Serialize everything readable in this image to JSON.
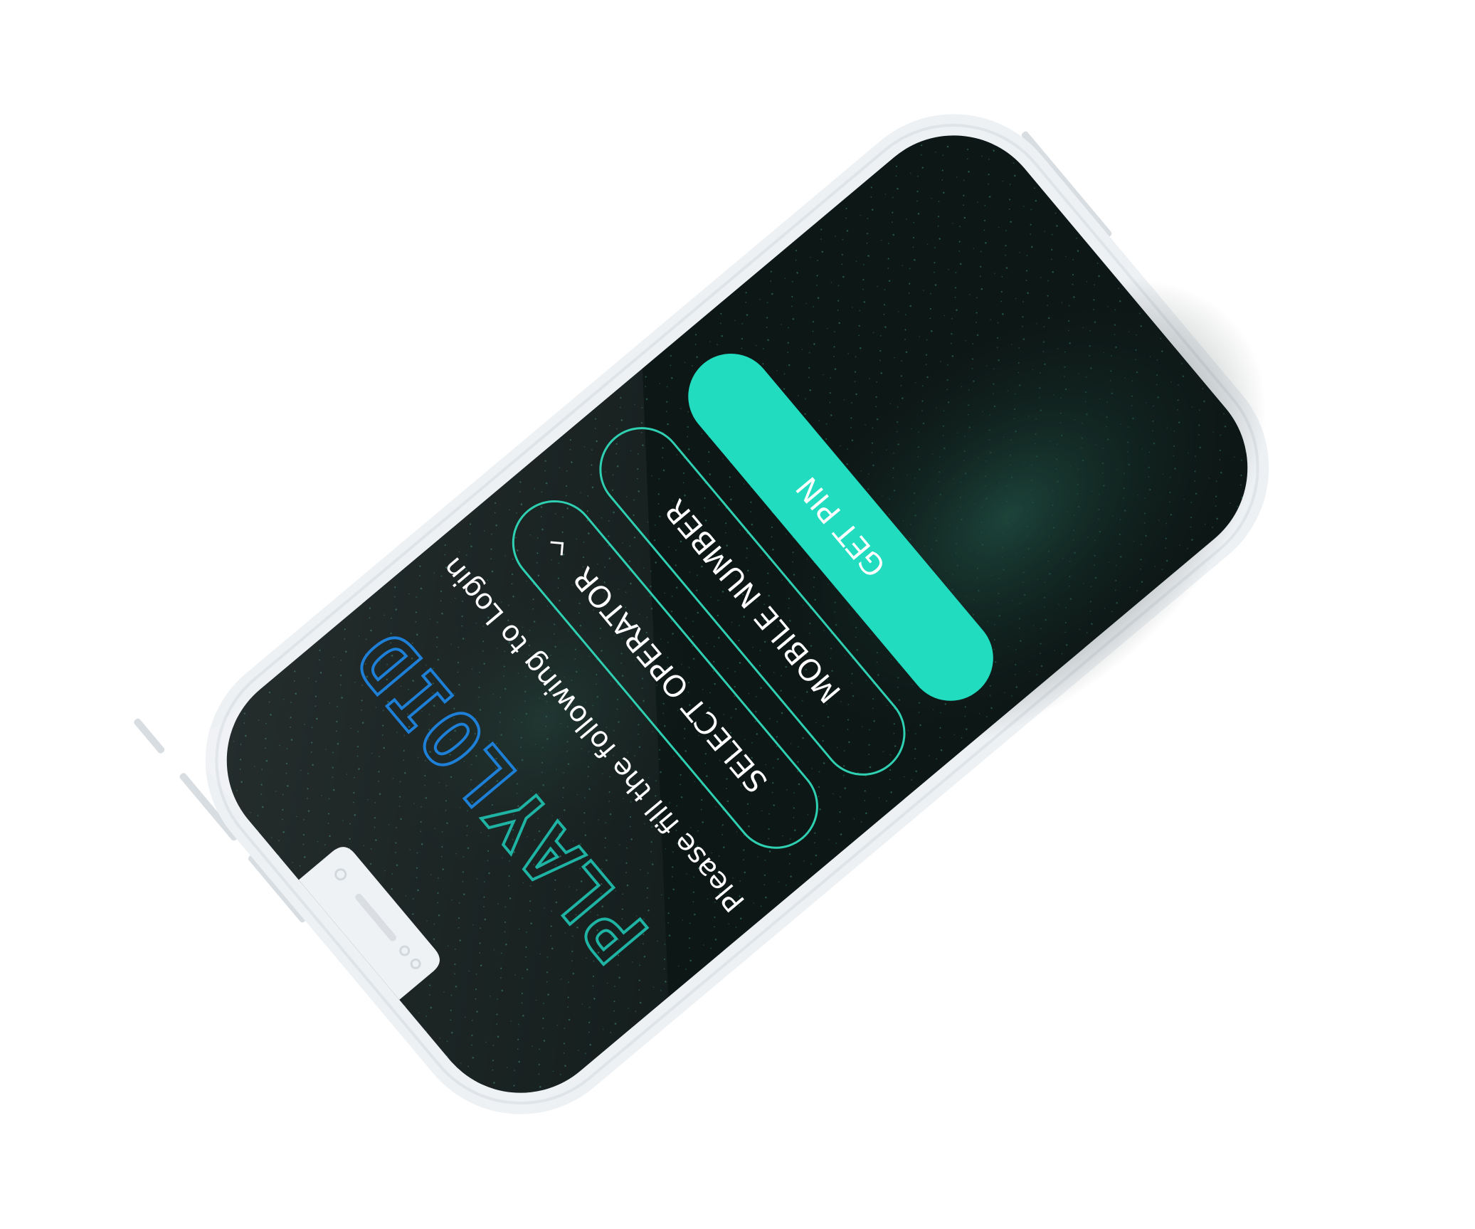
{
  "app": {
    "logo": {
      "part_a": "PLAY",
      "part_b": "LOID",
      "color_a": "#1fb3a4",
      "color_b": "#1e7fd6"
    },
    "instruction": "Please fill the following to Login"
  },
  "form": {
    "operator_label": "SELECT OPERATOR",
    "mobile_label": "MOBILE NUMBER",
    "get_pin_label": "GET PIN"
  },
  "colors": {
    "accent": "#22dcc0",
    "screen_bg": "#0d1716",
    "field_border": "#2fcfb2",
    "device_body": "#eef1f4"
  },
  "icons": {
    "operator_dropdown": "chevron-down-icon"
  }
}
